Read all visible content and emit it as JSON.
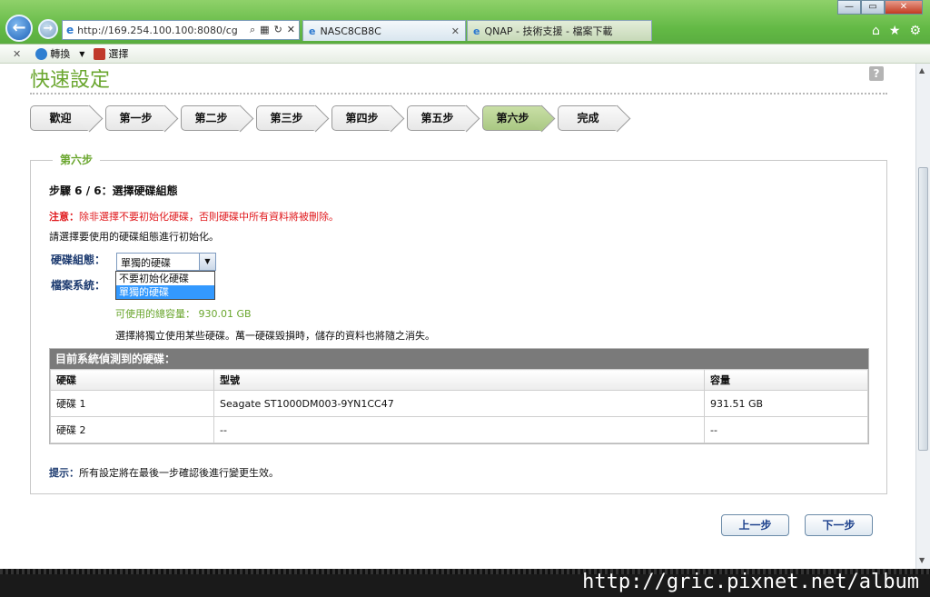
{
  "browser": {
    "address": "http://169.254.100.100:8080/cg",
    "tabs": [
      {
        "label": "NASC8CB8C",
        "close": "✕"
      },
      {
        "label": "QNAP - 技術支援 - 檔案下載",
        "close": ""
      }
    ],
    "window_buttons": [
      "—",
      "▭",
      "✕"
    ],
    "tool_icons": [
      "⌂",
      "★",
      "⚙"
    ],
    "command_bar": {
      "close": "✕",
      "convert_label": "轉換",
      "dropdown": "▼",
      "select_label": "選擇"
    }
  },
  "page": {
    "title": "快速設定",
    "help": "?",
    "steps": [
      {
        "label": "歡迎",
        "active": false
      },
      {
        "label": "第一步",
        "active": false
      },
      {
        "label": "第二步",
        "active": false
      },
      {
        "label": "第三步",
        "active": false
      },
      {
        "label": "第四步",
        "active": false
      },
      {
        "label": "第五步",
        "active": false
      },
      {
        "label": "第六步",
        "active": true
      },
      {
        "label": "完成",
        "active": false
      }
    ],
    "legend": "第六步",
    "heading": "步驟 6 / 6：選擇硬碟組態",
    "warning_prefix": "注意：",
    "warning_text": "除非選擇不要初始化硬碟，否則硬碟中所有資料將被刪除。",
    "instruction": "請選擇要使用的硬碟組態進行初始化。",
    "disk_config_label": "硬碟組態：",
    "disk_config_value": "單獨的硬碟",
    "disk_config_options": [
      "不要初始化硬碟",
      "單獨的硬碟"
    ],
    "filesystem_label": "檔案系統：",
    "capacity_text": "可使用的總容量： 930.01 GB",
    "note": "選擇將獨立使用某些硬碟。萬一硬碟毀損時，儲存的資料也將隨之消失。",
    "table": {
      "title": "目前系統偵測到的硬碟：",
      "columns": [
        "硬碟",
        "型號",
        "容量"
      ],
      "rows": [
        [
          "硬碟 1",
          "Seagate ST1000DM003-9YN1CC47",
          "931.51 GB"
        ],
        [
          "硬碟 2",
          "--",
          "--"
        ]
      ]
    },
    "tip_prefix": "提示：",
    "tip_text": "所有設定將在最後一步確認後進行變更生效。",
    "prev_button": "上一步",
    "next_button": "下一步"
  },
  "watermark": "http://gric.pixnet.net/album",
  "colors": {
    "accent_green": "#6aa62e",
    "warning_red": "#e0191d",
    "link_blue": "#1a3f8c"
  }
}
